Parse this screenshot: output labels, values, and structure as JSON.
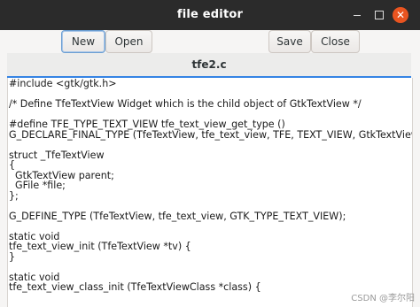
{
  "window": {
    "title": "file editor",
    "controls": {
      "minimize_icon": "minimize-icon",
      "maximize_icon": "maximize-icon",
      "close_icon": "close-icon"
    }
  },
  "toolbar": {
    "new_label": "New",
    "open_label": "Open",
    "save_label": "Save",
    "close_label": "Close"
  },
  "tabs": [
    {
      "label": "tfe2.c"
    }
  ],
  "editor": {
    "lines": [
      "#include <gtk/gtk.h>",
      "",
      "/* Define TfeTextView Widget which is the child object of GtkTextView */",
      "",
      "#define TFE_TYPE_TEXT_VIEW tfe_text_view_get_type ()",
      "G_DECLARE_FINAL_TYPE (TfeTextView, tfe_text_view, TFE, TEXT_VIEW, GtkTextView)",
      "",
      "struct _TfeTextView",
      "{",
      "  GtkTextView parent;",
      "  GFile *file;",
      "};",
      "",
      "G_DEFINE_TYPE (TfeTextView, tfe_text_view, GTK_TYPE_TEXT_VIEW);",
      "",
      "static void",
      "tfe_text_view_init (TfeTextView *tv) {",
      "}",
      "",
      "static void",
      "tfe_text_view_class_init (TfeTextViewClass *class) {"
    ]
  },
  "watermark": "CSDN @李尔阳",
  "colors": {
    "titlebar": "#2b2b2b",
    "close_button": "#e95420",
    "tab_underline": "#3584e4"
  }
}
